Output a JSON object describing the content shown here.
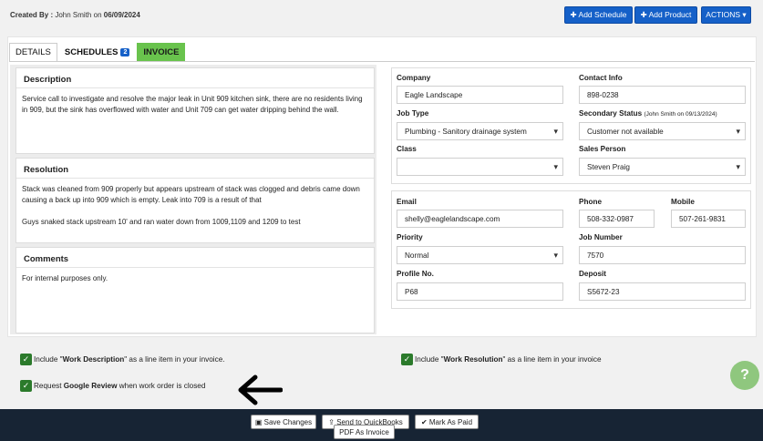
{
  "header": {
    "created_by_label": "Created By :",
    "created_by_name": "John Smith",
    "created_on_word": "on",
    "created_date": "06/09/2024",
    "add_schedule": "✚ Add Schedule",
    "add_product": "✚ Add Product",
    "actions": "ACTIONS ▾"
  },
  "tabs": {
    "details": "DETAILS",
    "schedules": "SCHEDULES",
    "schedules_count": "2",
    "invoice": "INVOICE"
  },
  "description": {
    "title": "Description",
    "text": "Service call to investigate and resolve the major leak in Unit 909 kitchen sink, there are no residents living in 909, but the sink has overflowed with water and Unit 709 can get water dripping behind the wall."
  },
  "resolution": {
    "title": "Resolution",
    "text1": "Stack was cleaned from 909 properly but appears upstream of stack was clogged and debris came down causing a back up into 909 which is empty.  Leak into 709 is a result of that",
    "text2": "Guys snaked stack upstream 10' and ran water down from 1009,1109 and 1209 to test"
  },
  "comments": {
    "title": "Comments",
    "text": "For internal purposes only."
  },
  "form": {
    "company_label": "Company",
    "company": "Eagle Landscape",
    "contact_label": "Contact Info",
    "contact": "898-0238",
    "job_type_label": "Job Type",
    "job_type": "Plumbing - Sanitory drainage system",
    "secondary_status_label": "Secondary Status",
    "secondary_status_note": "(John Smith on 09/13/2024)",
    "secondary_status": "Customer not available",
    "class_label": "Class",
    "class_value": "",
    "sales_person_label": "Sales Person",
    "sales_person": "Steven Praig",
    "email_label": "Email",
    "email": "shelly@eaglelandscape.com",
    "phone_label": "Phone",
    "phone": "508-332-0987",
    "mobile_label": "Mobile",
    "mobile": "507-261-9831",
    "priority_label": "Priority",
    "priority": "Normal",
    "job_number_label": "Job Number",
    "job_number": "7570",
    "profile_label": "Profile No.",
    "profile": "P68",
    "deposit_label": "Deposit",
    "deposit": "S5672-23"
  },
  "options": {
    "include_desc_pre": "Include \"",
    "include_desc_bold": "Work Description",
    "include_desc_post": "\" as a line item in your invoice.",
    "include_res_pre": "Include \"",
    "include_res_bold": "Work Resolution",
    "include_res_post": "\" as a line item in your invoice",
    "review_pre": "Request ",
    "review_bold": "Google Review",
    "review_post": " when work order is closed"
  },
  "footer": {
    "save": "Save Changes",
    "send_qb": "Send to QuickBooks",
    "mark_paid": "✔ Mark As Paid",
    "pdf": "PDF As Invoice"
  },
  "help_glyph": "?",
  "icons": [
    "check-icon",
    "arrow-left-icon",
    "floppy-icon",
    "upload-icon",
    "help-icon",
    "plus-icon",
    "caret-down-icon"
  ],
  "colors": {
    "primary": "#1560c8",
    "invoice_tab": "#69c34d",
    "check": "#2b7a2b",
    "footer": "#172434",
    "help": "#8fc77e"
  }
}
